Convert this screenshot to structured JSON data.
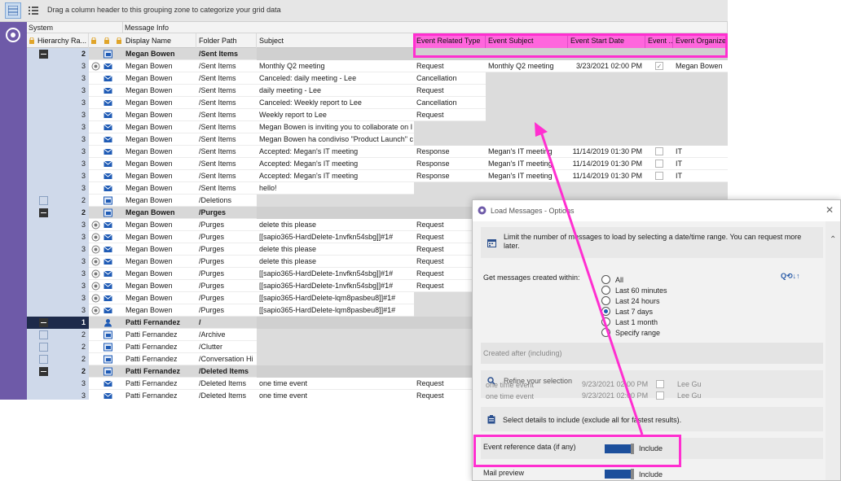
{
  "toolbar": {
    "group_hint": "Drag a column header to this grouping zone to categorize your grid data"
  },
  "bands": {
    "system": "System",
    "message_info": "Message Info"
  },
  "headers": {
    "hierarchy": "Hierarchy Ra...",
    "display_name": "Display Name",
    "folder_path": "Folder Path",
    "subject": "Subject",
    "event_related_type": "Event Related Type",
    "event_subject": "Event Subject",
    "event_start_date": "Event Start Date",
    "event_short": "Event ...",
    "event_organizer": "Event Organizer"
  },
  "colors": {
    "sidebar": "#6e5aa8",
    "highlight": "#ff66dd",
    "annotation": "#ff2fd0",
    "toggle": "#1c4f9c"
  },
  "rows": [
    {
      "type": "group",
      "level": "2",
      "name": "Megan Bowen",
      "folder": "/Sent Items"
    },
    {
      "level": "3",
      "icon": "mail-outbox-icon",
      "name": "Megan Bowen",
      "folder": "/Sent Items",
      "subject": "Monthly Q2 meeting",
      "ert": "Request",
      "es": "Monthly Q2 meeting",
      "esd": "3/23/2021 02:00 PM",
      "chk": "checked",
      "eo": "Megan Bowen"
    },
    {
      "level": "3",
      "icon": "mail-icon",
      "name": "Megan Bowen",
      "folder": "/Sent Items",
      "subject": "Canceled: daily meeting - Lee",
      "ert": "Cancellation",
      "es": "",
      "esd": "",
      "chk": "",
      "eo": "",
      "greyTail": true
    },
    {
      "level": "3",
      "icon": "mail-icon",
      "name": "Megan Bowen",
      "folder": "/Sent Items",
      "subject": "daily meeting - Lee",
      "ert": "Request",
      "es": "",
      "esd": "",
      "chk": "",
      "eo": "",
      "greyTail": true
    },
    {
      "level": "3",
      "icon": "mail-icon",
      "name": "Megan Bowen",
      "folder": "/Sent Items",
      "subject": "Canceled: Weekly report to Lee",
      "ert": "Cancellation",
      "es": "",
      "esd": "",
      "chk": "",
      "eo": "",
      "greyTail": true
    },
    {
      "level": "3",
      "icon": "mail-icon",
      "name": "Megan Bowen",
      "folder": "/Sent Items",
      "subject": "Weekly report to Lee",
      "ert": "Request",
      "es": "",
      "esd": "",
      "chk": "",
      "eo": "",
      "greyTail": true
    },
    {
      "level": "3",
      "icon": "mail-icon",
      "name": "Megan Bowen",
      "folder": "/Sent Items",
      "subject": "Megan Bowen is inviting you to collaborate on I",
      "ert": "",
      "es": "",
      "esd": "",
      "chk": "",
      "eo": "",
      "greyFromErt": true
    },
    {
      "level": "3",
      "icon": "mail-icon",
      "name": "Megan Bowen",
      "folder": "/Sent Items",
      "subject": "Megan Bowen ha condiviso \"Product Launch\" c",
      "ert": "",
      "es": "",
      "esd": "",
      "chk": "",
      "eo": "",
      "greyFromErt": true
    },
    {
      "level": "3",
      "icon": "mail-icon",
      "name": "Megan Bowen",
      "folder": "/Sent Items",
      "subject": "Accepted: Megan's IT meeting",
      "ert": "Response",
      "es": "Megan's IT meeting",
      "esd": "11/14/2019 01:30 PM",
      "chk": "box",
      "eo": "IT"
    },
    {
      "level": "3",
      "icon": "mail-icon",
      "name": "Megan Bowen",
      "folder": "/Sent Items",
      "subject": "Accepted: Megan's IT meeting",
      "ert": "Response",
      "es": "Megan's IT meeting",
      "esd": "11/14/2019 01:30 PM",
      "chk": "box",
      "eo": "IT"
    },
    {
      "level": "3",
      "icon": "mail-icon",
      "name": "Megan Bowen",
      "folder": "/Sent Items",
      "subject": "Accepted: Megan's IT meeting",
      "ert": "Response",
      "es": "Megan's IT meeting",
      "esd": "11/14/2019 01:30 PM",
      "chk": "box",
      "eo": "IT"
    },
    {
      "level": "3",
      "icon": "mail-icon",
      "name": "Megan Bowen",
      "folder": "/Sent Items",
      "subject": "hello!",
      "ert": "",
      "es": "",
      "esd": "",
      "chk": "",
      "eo": "",
      "greyFromErt": true
    },
    {
      "type": "folder",
      "level": "2",
      "icon": "folder-mail-icon",
      "name": "Megan Bowen",
      "folder": "/Deletions"
    },
    {
      "type": "group",
      "level": "2",
      "name": "Megan Bowen",
      "folder": "/Purges"
    },
    {
      "level": "3",
      "icon": "mail-outbox-icon",
      "name": "Megan Bowen",
      "folder": "/Purges",
      "subject": "delete this please",
      "ert": "Request",
      "es": "",
      "esd": "",
      "chk": "",
      "eo": ""
    },
    {
      "level": "3",
      "icon": "mail-outbox-icon",
      "name": "Megan Bowen",
      "folder": "/Purges",
      "subject": "[[sapio365-HardDelete-1nvfkn54sbg]]#1#",
      "ert": "Request",
      "es": "",
      "esd": "",
      "chk": "",
      "eo": ""
    },
    {
      "level": "3",
      "icon": "mail-outbox-icon",
      "name": "Megan Bowen",
      "folder": "/Purges",
      "subject": "delete this please",
      "ert": "Request",
      "es": "",
      "esd": "",
      "chk": "",
      "eo": ""
    },
    {
      "level": "3",
      "icon": "mail-outbox-icon",
      "name": "Megan Bowen",
      "folder": "/Purges",
      "subject": "delete this please",
      "ert": "Request",
      "es": "",
      "esd": "",
      "chk": "",
      "eo": ""
    },
    {
      "level": "3",
      "icon": "mail-outbox-icon",
      "name": "Megan Bowen",
      "folder": "/Purges",
      "subject": "[[sapio365-HardDelete-1nvfkn54sbg]]#1#",
      "ert": "Request",
      "es": "",
      "esd": "",
      "chk": "",
      "eo": ""
    },
    {
      "level": "3",
      "icon": "mail-outbox-icon",
      "name": "Megan Bowen",
      "folder": "/Purges",
      "subject": "[[sapio365-HardDelete-1nvfkn54sbg]]#1#",
      "ert": "Request",
      "es": "",
      "esd": "",
      "chk": "",
      "eo": ""
    },
    {
      "level": "3",
      "icon": "mail-outbox-icon",
      "name": "Megan Bowen",
      "folder": "/Purges",
      "subject": "[[sapio365-HardDelete-lqm8pasbeu8]]#1#",
      "ert": "",
      "es": "",
      "esd": "",
      "chk": "",
      "eo": "",
      "greyFromErt": true
    },
    {
      "level": "3",
      "icon": "mail-outbox-icon",
      "name": "Megan Bowen",
      "folder": "/Purges",
      "subject": "[[sapio365-HardDelete-lqm8pasbeu8]]#1#",
      "ert": "",
      "es": "",
      "esd": "",
      "chk": "",
      "eo": "",
      "greyFromErt": true
    },
    {
      "type": "group",
      "level": "1",
      "icon": "user-icon",
      "name": "Patti Fernandez",
      "folder": "/"
    },
    {
      "type": "folder",
      "level": "2",
      "icon": "folder-mail-icon",
      "name": "Patti Fernandez",
      "folder": "/Archive"
    },
    {
      "type": "folder",
      "level": "2",
      "icon": "folder-mail-icon",
      "name": "Patti Fernandez",
      "folder": "/Clutter"
    },
    {
      "type": "folder",
      "level": "2",
      "icon": "folder-mail-icon",
      "name": "Patti Fernandez",
      "folder": "/Conversation Hi"
    },
    {
      "type": "group",
      "level": "2",
      "name": "Patti Fernandez",
      "folder": "/Deleted Items"
    },
    {
      "level": "3",
      "icon": "mail-icon",
      "name": "Patti Fernandez",
      "folder": "/Deleted Items",
      "subject": "one time event",
      "ert": "Request",
      "es": "",
      "esd": "",
      "chk": "",
      "eo": ""
    },
    {
      "level": "3",
      "icon": "mail-icon",
      "name": "Patti Fernandez",
      "folder": "/Deleted Items",
      "subject": "one time event",
      "ert": "Request",
      "es": "",
      "esd": "",
      "chk": "",
      "eo": ""
    }
  ],
  "dialog": {
    "title": "Load Messages - Options",
    "info": "Limit the number of messages to load by selecting a date/time range. You can request more later.",
    "get_messages_label": "Get messages created within:",
    "options": [
      "All",
      "Last 60 minutes",
      "Last 24 hours",
      "Last 7 days",
      "Last 1 month",
      "Specify range"
    ],
    "selected": "Last 7 days",
    "created_after": "Created after (including)",
    "refine": "Refine your selection",
    "ghost_row1": {
      "subject": "one time event",
      "date": "9/23/2021 02:00 PM",
      "org": "Lee Gu"
    },
    "ghost_row2": {
      "subject": "one time event",
      "date": "9/23/2021 02:00 PM",
      "org": "Lee Gu"
    },
    "select_details": "Select details to include (exclude all for fastest results).",
    "event_reference_label": "Event reference data (if any)",
    "event_reference_value": "Include",
    "mail_preview_label": "Mail preview",
    "mail_preview_value": "Include",
    "tool_icons": "Q⟲↓↑"
  }
}
